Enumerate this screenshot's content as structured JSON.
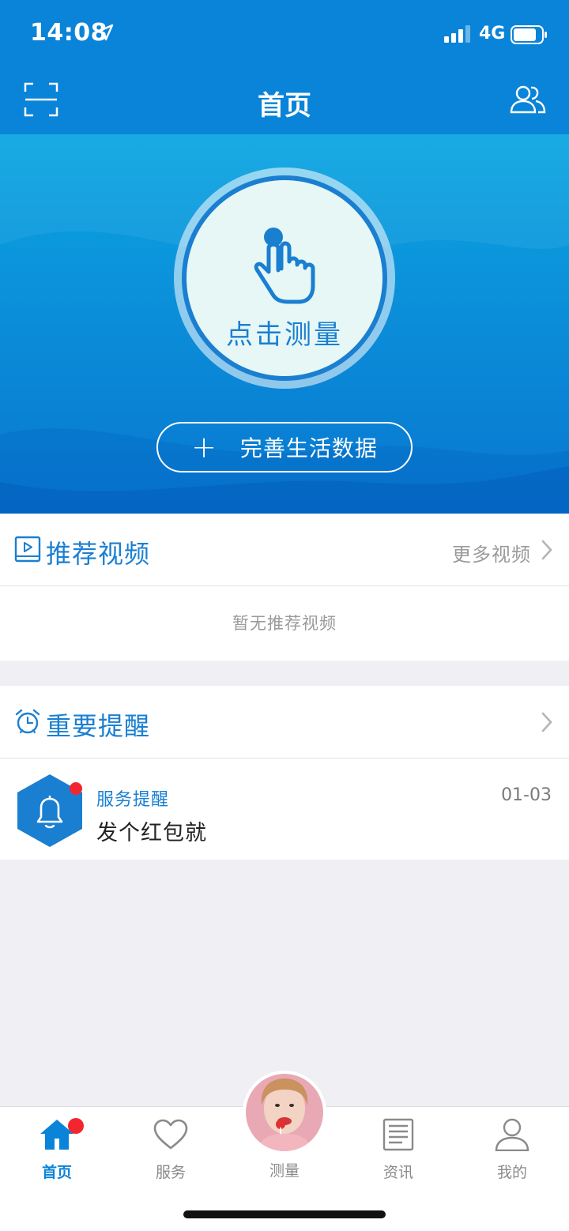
{
  "status_bar": {
    "time": "14:08",
    "network": "4G"
  },
  "header": {
    "title": "首页"
  },
  "hero": {
    "measure_label": "点击测量",
    "life_data_label": "完善生活数据",
    "plus_glyph": "+"
  },
  "videos": {
    "title": "推荐视频",
    "more_label": "更多视频",
    "empty_text": "暂无推荐视频"
  },
  "reminders": {
    "title": "重要提醒",
    "items": [
      {
        "type": "服务提醒",
        "date": "01-03",
        "text": "发个红包就"
      }
    ]
  },
  "tabbar": {
    "items": [
      {
        "label": "首页",
        "icon": "home-icon",
        "active": true
      },
      {
        "label": "服务",
        "icon": "heart-icon"
      },
      {
        "label": "测量",
        "icon": "avatar"
      },
      {
        "label": "资讯",
        "icon": "news-icon"
      },
      {
        "label": "我的",
        "icon": "person-icon"
      }
    ]
  },
  "colors": {
    "primary": "#0a84d8",
    "accent": "#1a7fd1",
    "badge": "#f2262f",
    "background": "#efeff4"
  }
}
